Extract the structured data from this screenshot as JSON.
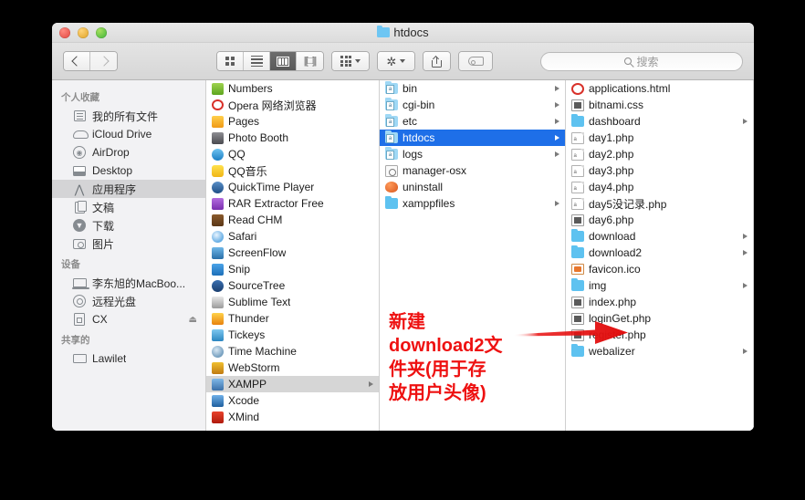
{
  "window": {
    "title": "htdocs",
    "title_icon": "folder-icon",
    "traffic_lights": [
      "close",
      "minimize",
      "maximize"
    ]
  },
  "toolbar": {
    "back_icon": "chevron-left-icon",
    "forward_icon": "chevron-right-icon",
    "view_icon_label": "icon-view",
    "view_list_label": "list-view",
    "view_column_label": "column-view",
    "view_cover_label": "coverflow-view",
    "arrange_label": "arrange-by",
    "action_label": "action-gear",
    "share_label": "share",
    "tag_label": "edit-tags",
    "active_view": "column-view"
  },
  "search": {
    "placeholder": "搜索",
    "icon": "search-icon",
    "value": ""
  },
  "sidebar": {
    "sections": [
      {
        "header": "个人收藏",
        "items": [
          {
            "label": "我的所有文件",
            "icon": "all-files-icon",
            "selected": false
          },
          {
            "label": "iCloud Drive",
            "icon": "icloud-icon",
            "selected": false
          },
          {
            "label": "AirDrop",
            "icon": "airdrop-icon",
            "selected": false
          },
          {
            "label": "Desktop",
            "icon": "desktop-icon",
            "selected": false
          },
          {
            "label": "应用程序",
            "icon": "applications-icon",
            "selected": true
          },
          {
            "label": "文稿",
            "icon": "documents-icon",
            "selected": false
          },
          {
            "label": "下载",
            "icon": "downloads-icon",
            "selected": false
          },
          {
            "label": "图片",
            "icon": "pictures-icon",
            "selected": false
          }
        ]
      },
      {
        "header": "设备",
        "items": [
          {
            "label": "李东旭的MacBoo...",
            "icon": "laptop-icon",
            "selected": false
          },
          {
            "label": "远程光盘",
            "icon": "remote-disc-icon",
            "selected": false
          },
          {
            "label": "CX",
            "icon": "drive-icon",
            "selected": false,
            "eject": "⏏"
          }
        ]
      },
      {
        "header": "共享的",
        "items": [
          {
            "label": "Lawilet",
            "icon": "shared-computer-icon",
            "selected": false
          }
        ]
      }
    ]
  },
  "columns": [
    {
      "name": "applications-column",
      "items": [
        {
          "label": "Numbers",
          "icon": "app-numbers",
          "kind": "app",
          "selected": false,
          "has_children": false
        },
        {
          "label": "Opera 网络浏览器",
          "icon": "app-opera",
          "kind": "app",
          "selected": false,
          "has_children": false
        },
        {
          "label": "Pages",
          "icon": "app-pages",
          "kind": "app",
          "selected": false,
          "has_children": false
        },
        {
          "label": "Photo Booth",
          "icon": "app-photo",
          "kind": "app",
          "selected": false,
          "has_children": false
        },
        {
          "label": "QQ",
          "icon": "app-qq",
          "kind": "app",
          "selected": false,
          "has_children": false
        },
        {
          "label": "QQ音乐",
          "icon": "app-qqmusic",
          "kind": "app",
          "selected": false,
          "has_children": false
        },
        {
          "label": "QuickTime Player",
          "icon": "app-quicktime",
          "kind": "app",
          "selected": false,
          "has_children": false
        },
        {
          "label": "RAR Extractor Free",
          "icon": "app-rar",
          "kind": "app",
          "selected": false,
          "has_children": false
        },
        {
          "label": "Read CHM",
          "icon": "app-readchm",
          "kind": "app",
          "selected": false,
          "has_children": false
        },
        {
          "label": "Safari",
          "icon": "app-safari",
          "kind": "app",
          "selected": false,
          "has_children": false
        },
        {
          "label": "ScreenFlow",
          "icon": "app-screenflow",
          "kind": "app",
          "selected": false,
          "has_children": false
        },
        {
          "label": "Snip",
          "icon": "app-snip",
          "kind": "app",
          "selected": false,
          "has_children": false
        },
        {
          "label": "SourceTree",
          "icon": "app-sourcetree",
          "kind": "app",
          "selected": false,
          "has_children": false
        },
        {
          "label": "Sublime Text",
          "icon": "app-sublime",
          "kind": "app",
          "selected": false,
          "has_children": false
        },
        {
          "label": "Thunder",
          "icon": "app-thunder",
          "kind": "app",
          "selected": false,
          "has_children": false
        },
        {
          "label": "Tickeys",
          "icon": "app-tickeys",
          "kind": "app",
          "selected": false,
          "has_children": false
        },
        {
          "label": "Time Machine",
          "icon": "app-timemachine",
          "kind": "app",
          "selected": false,
          "has_children": false
        },
        {
          "label": "WebStorm",
          "icon": "app-webstorm",
          "kind": "app",
          "selected": false,
          "has_children": false
        },
        {
          "label": "XAMPP",
          "icon": "app-xampp",
          "kind": "app",
          "selected": "gray",
          "has_children": true
        },
        {
          "label": "Xcode",
          "icon": "app-xcode",
          "kind": "app",
          "selected": false,
          "has_children": false
        },
        {
          "label": "XMind",
          "icon": "app-xmind",
          "kind": "app",
          "selected": false,
          "has_children": false
        }
      ]
    },
    {
      "name": "xampp-column",
      "items": [
        {
          "label": "bin",
          "icon": "folder-alias-icon",
          "kind": "folder-php",
          "selected": false,
          "has_children": true
        },
        {
          "label": "cgi-bin",
          "icon": "folder-alias-icon",
          "kind": "folder-php",
          "selected": false,
          "has_children": true
        },
        {
          "label": "etc",
          "icon": "folder-alias-icon",
          "kind": "folder-php",
          "selected": false,
          "has_children": true
        },
        {
          "label": "htdocs",
          "icon": "folder-alias-icon",
          "kind": "folder-php",
          "selected": "blue",
          "has_children": true
        },
        {
          "label": "logs",
          "icon": "folder-alias-icon",
          "kind": "folder-php",
          "selected": false,
          "has_children": true
        },
        {
          "label": "manager-osx",
          "icon": "app-manager-icon",
          "kind": "manager",
          "selected": false,
          "has_children": false
        },
        {
          "label": "uninstall",
          "icon": "uninstaller-icon",
          "kind": "uninstall",
          "selected": false,
          "has_children": false
        },
        {
          "label": "xamppfiles",
          "icon": "folder-icon",
          "kind": "folder",
          "selected": false,
          "has_children": true
        }
      ]
    },
    {
      "name": "htdocs-column",
      "items": [
        {
          "label": "applications.html",
          "icon": "opera-html-icon",
          "kind": "opera",
          "selected": false,
          "has_children": false
        },
        {
          "label": "bitnami.css",
          "icon": "css-file-icon",
          "kind": "doc-dark",
          "selected": false,
          "has_children": false
        },
        {
          "label": "dashboard",
          "icon": "folder-icon",
          "kind": "folder",
          "selected": false,
          "has_children": true
        },
        {
          "label": "day1.php",
          "icon": "php-file-icon",
          "kind": "doc-php",
          "selected": false,
          "has_children": false
        },
        {
          "label": "day2.php",
          "icon": "php-file-icon",
          "kind": "doc-php",
          "selected": false,
          "has_children": false
        },
        {
          "label": "day3.php",
          "icon": "php-file-icon",
          "kind": "doc-php",
          "selected": false,
          "has_children": false
        },
        {
          "label": "day4.php",
          "icon": "php-file-icon",
          "kind": "doc-php",
          "selected": false,
          "has_children": false
        },
        {
          "label": "day5没记录.php",
          "icon": "php-file-icon",
          "kind": "doc-php",
          "selected": false,
          "has_children": false
        },
        {
          "label": "day6.php",
          "icon": "php-file-icon",
          "kind": "doc-dark",
          "selected": false,
          "has_children": false
        },
        {
          "label": "download",
          "icon": "folder-icon",
          "kind": "folder",
          "selected": false,
          "has_children": true
        },
        {
          "label": "download2",
          "icon": "folder-icon",
          "kind": "folder",
          "selected": false,
          "has_children": true
        },
        {
          "label": "favicon.ico",
          "icon": "ico-file-icon",
          "kind": "ico",
          "selected": false,
          "has_children": false
        },
        {
          "label": "img",
          "icon": "folder-icon",
          "kind": "folder",
          "selected": false,
          "has_children": true
        },
        {
          "label": "index.php",
          "icon": "php-file-icon",
          "kind": "doc-dark",
          "selected": false,
          "has_children": false
        },
        {
          "label": "loginGet.php",
          "icon": "php-file-icon",
          "kind": "doc-dark",
          "selected": false,
          "has_children": false
        },
        {
          "label": "register.php",
          "icon": "php-file-icon",
          "kind": "doc-dark",
          "selected": false,
          "has_children": false
        },
        {
          "label": "webalizer",
          "icon": "folder-icon",
          "kind": "folder",
          "selected": false,
          "has_children": true
        }
      ]
    }
  ],
  "annotation": {
    "text": "新建download2文件夹(用于存放用户头像)",
    "color": "#ee1111",
    "arrow": {
      "name": "red-arrow-pointing-right",
      "color": "#e01010",
      "direction": "right",
      "target": "download2"
    }
  }
}
